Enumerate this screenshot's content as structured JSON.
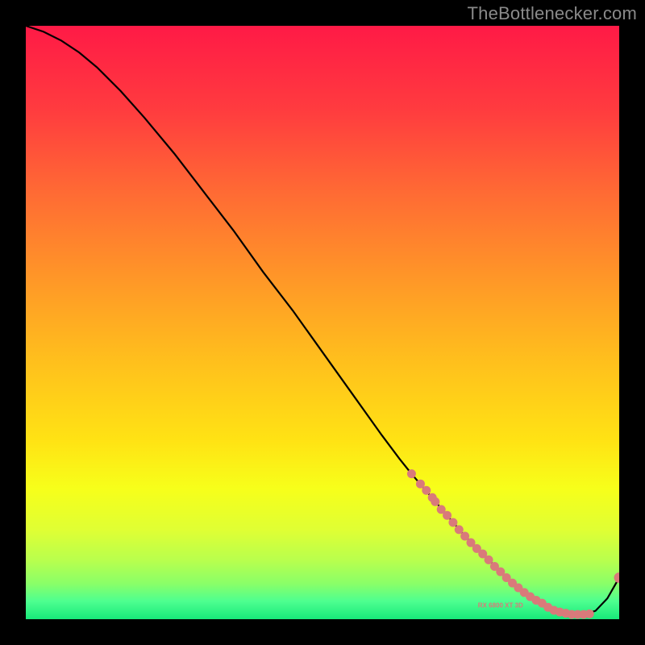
{
  "watermark": "TheBottlenecker.com",
  "colors": {
    "gradient_stops": [
      {
        "offset": 0.0,
        "color": "#ff1a46"
      },
      {
        "offset": 0.14,
        "color": "#ff3b3f"
      },
      {
        "offset": 0.28,
        "color": "#ff6a34"
      },
      {
        "offset": 0.42,
        "color": "#ff9528"
      },
      {
        "offset": 0.56,
        "color": "#ffbe1d"
      },
      {
        "offset": 0.7,
        "color": "#ffe314"
      },
      {
        "offset": 0.78,
        "color": "#f7ff1a"
      },
      {
        "offset": 0.85,
        "color": "#dfff34"
      },
      {
        "offset": 0.9,
        "color": "#b9ff4d"
      },
      {
        "offset": 0.94,
        "color": "#8aff68"
      },
      {
        "offset": 0.97,
        "color": "#4dff90"
      },
      {
        "offset": 1.0,
        "color": "#18e87a"
      }
    ],
    "curve": "#000000",
    "marker": "#d97a7a"
  },
  "chart_data": {
    "type": "line",
    "title": "",
    "xlabel": "",
    "ylabel": "",
    "xlim": [
      0,
      100
    ],
    "ylim": [
      0,
      100
    ],
    "grid": false,
    "legend": false,
    "annotations": [
      "RX 6800 XT 3D"
    ],
    "series": [
      {
        "name": "bottleneck-curve",
        "x": [
          0,
          3,
          6,
          9,
          12,
          16,
          20,
          25,
          30,
          35,
          40,
          45,
          50,
          55,
          60,
          63,
          65,
          68,
          71,
          74,
          77,
          80,
          83,
          86,
          88,
          90,
          92,
          94,
          96,
          98,
          100
        ],
        "y": [
          100,
          99,
          97.5,
          95.5,
          93,
          89,
          84.5,
          78.5,
          72,
          65.5,
          58.5,
          52,
          45,
          38,
          31,
          27,
          24.5,
          21,
          17.5,
          14,
          11,
          8,
          5.3,
          3.2,
          2.0,
          1.2,
          0.8,
          0.8,
          1.4,
          3.5,
          7
        ]
      }
    ],
    "markers": {
      "name": "highlight-points",
      "x": [
        65,
        66.5,
        67.5,
        68.5,
        69,
        70,
        71,
        72,
        73,
        74,
        75,
        76,
        77,
        78,
        79,
        80,
        81,
        82,
        83,
        84,
        85,
        86,
        87,
        88,
        89,
        90,
        91,
        92,
        93,
        94,
        95,
        100
      ],
      "y": [
        24.5,
        22.8,
        21.7,
        20.5,
        19.8,
        18.5,
        17.5,
        16.3,
        15.1,
        14.0,
        12.9,
        11.9,
        11.0,
        10.0,
        8.9,
        8.0,
        7.0,
        6.1,
        5.3,
        4.5,
        3.8,
        3.2,
        2.7,
        2.0,
        1.5,
        1.2,
        1.0,
        0.8,
        0.8,
        0.8,
        0.9,
        7
      ]
    }
  }
}
